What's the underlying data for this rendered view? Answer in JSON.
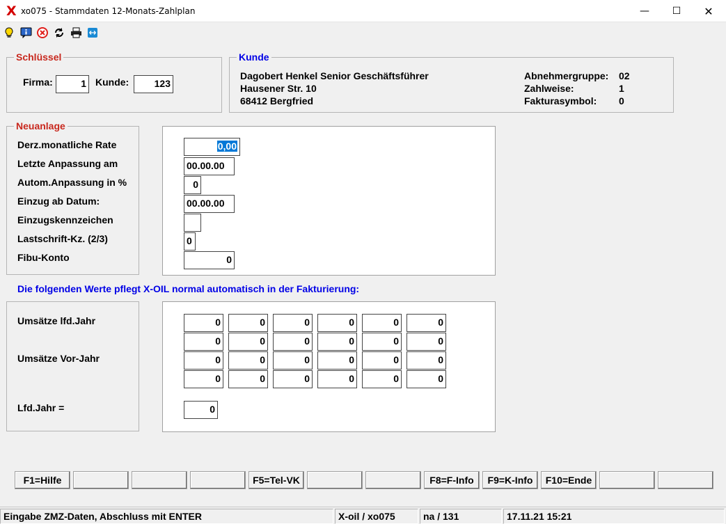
{
  "window": {
    "logo": "X",
    "title": "xo075 - Stammdaten 12-Monats-Zahlplan",
    "min_symbol": "—",
    "max_symbol": "☐",
    "close_symbol": "✕"
  },
  "toolbar": {
    "icons": [
      "lightbulb-icon",
      "info-icon",
      "cancel-icon",
      "refresh-icon",
      "printer-icon",
      "remote-icon"
    ]
  },
  "schluessel": {
    "legend": "Schlüssel",
    "firma_label": "Firma:",
    "firma_value": "1",
    "kunde_label": "Kunde:",
    "kunde_value": "123"
  },
  "kunde": {
    "legend": "Kunde",
    "name": "Dagobert Henkel Senior Geschäftsführer",
    "street": "Hausener Str. 10",
    "city": "68412  Bergfried",
    "abnehmergruppe_label": "Abnehmergruppe:",
    "abnehmergruppe_value": "02",
    "zahlweise_label": "Zahlweise:",
    "zahlweise_value": "1",
    "fakturasymbol_label": "Fakturasymbol:",
    "fakturasymbol_value": "0"
  },
  "neuanlage": {
    "legend": "Neuanlage",
    "labels": {
      "rate": "Derz.monatliche Rate",
      "anpassung": "Letzte Anpassung am",
      "autom": "Autom.Anpassung in %",
      "einzug": "Einzug ab Datum:",
      "einzugskennzeichen": "Einzugskennzeichen",
      "lastschrift": "Lastschrift-Kz. (2/3)",
      "fibu": "Fibu-Konto"
    },
    "values": {
      "rate": "0,00",
      "anpassung": "00.00.00",
      "autom": "0",
      "einzug": "00.00.00",
      "einzugskennzeichen": "",
      "lastschrift": "0",
      "fibu": "0"
    }
  },
  "info_text": "Die folgenden Werte pflegt X-OIL normal automatisch in der Fakturierung:",
  "umsaetze": {
    "lfd_label": "Umsätze lfd.Jahr",
    "vor_label": "Umsätze Vor-Jahr",
    "lfd_jahr_label": "Lfd.Jahr =",
    "lfd_jahr_value": "0",
    "rows": [
      [
        "0",
        "0",
        "0",
        "0",
        "0",
        "0"
      ],
      [
        "0",
        "0",
        "0",
        "0",
        "0",
        "0"
      ],
      [
        "0",
        "0",
        "0",
        "0",
        "0",
        "0"
      ],
      [
        "0",
        "0",
        "0",
        "0",
        "0",
        "0"
      ]
    ]
  },
  "function_keys": [
    "F1=Hilfe",
    "",
    "",
    "",
    "F5=Tel-VK",
    "",
    "",
    "F8=F-Info",
    "F9=K-Info",
    "F10=Ende",
    "",
    ""
  ],
  "status": {
    "message": "Eingabe ZMZ-Daten, Abschluss mit ENTER",
    "program": "X-oil / xo075",
    "user": "na / 131",
    "datetime": "17.11.21 15:21"
  }
}
